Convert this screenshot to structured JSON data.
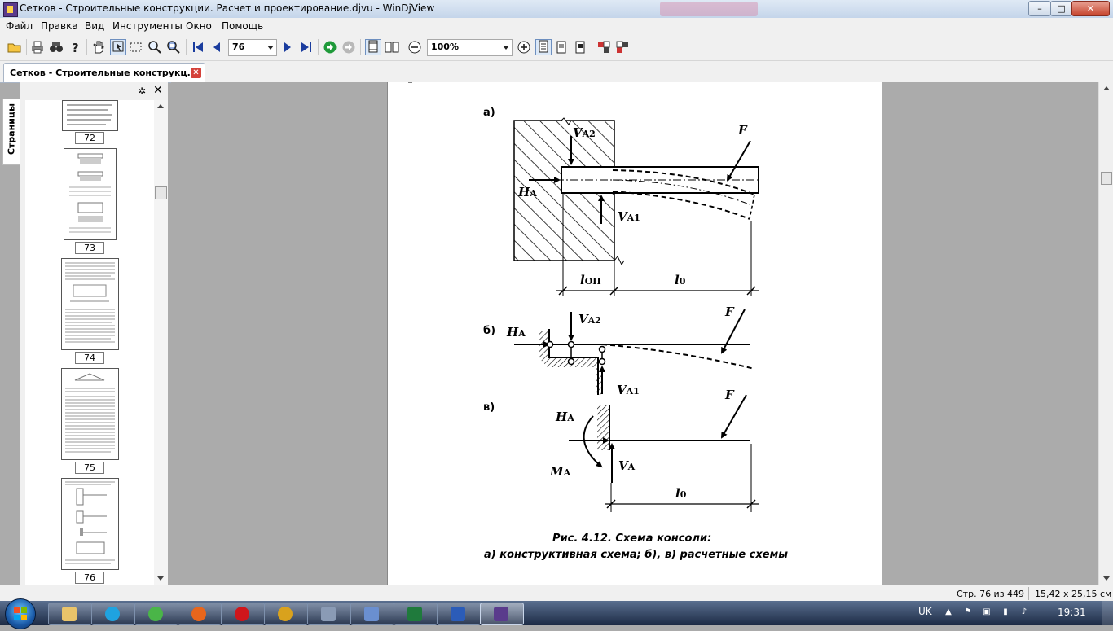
{
  "window": {
    "title": "Сетков - Строительные конструкции. Расчет и проектирование.djvu - WinDjView",
    "minimize": "–",
    "maximize": "□",
    "close": "✕"
  },
  "menu": [
    "Файл",
    "Правка",
    "Вид",
    "Инструменты",
    "Окно",
    "Помощь"
  ],
  "toolbar": {
    "page_value": "76",
    "zoom_value": "100%"
  },
  "tab": {
    "label": "Сетков - Строительные конструкц...",
    "close": "✕"
  },
  "sidebar": {
    "tab_label": "Страницы",
    "settings": "✲",
    "close": "✕",
    "thumbnails": [
      "72",
      "73",
      "74",
      "75",
      "76"
    ]
  },
  "figure": {
    "label_a": "а)",
    "label_b": "б)",
    "label_v": "в)",
    "F": "F",
    "V": "V",
    "H": "H",
    "M": "M",
    "l": "l",
    "sub_A2": "A2",
    "sub_A1": "A1",
    "sub_A": "A",
    "sub_op": "ОП",
    "sub_0": "0",
    "caption_line1": "Рис. 4.12. Схема консоли:",
    "caption_line2": "а) конструктивная схема; б), в) расчетные схемы"
  },
  "status": {
    "page_info": "Стр. 76 из 449",
    "page_size": "15,42 x 25,15 см"
  },
  "taskbar": {
    "lang": "UK",
    "time": "19:31"
  }
}
